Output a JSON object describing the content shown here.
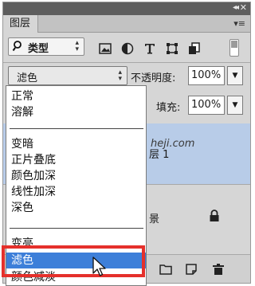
{
  "panel": {
    "tab_label": "图层",
    "collapse_glyph": "◂◂",
    "close_glyph": "✕",
    "menu_glyph": "▾≡"
  },
  "filter": {
    "kind_label": "类型",
    "kind_arrows": "▴▾",
    "icons": [
      "image-filter-icon",
      "adjustment-filter-icon",
      "type-filter-icon",
      "shape-filter-icon",
      "smart-object-filter-icon"
    ]
  },
  "blend": {
    "value": "滤色",
    "arrows": "▴▾",
    "opacity_label": "不透明度:",
    "opacity_value": "100%",
    "fill_label": "填充:",
    "fill_value": "100%",
    "dropdown_glyph": "▼"
  },
  "layers": {
    "selected_fragment": "层 1",
    "watermark": "heji.com",
    "background_fragment": "景"
  },
  "blend_menu": {
    "groups": [
      [
        "正常",
        "溶解"
      ],
      [
        "变暗",
        "正片叠底",
        "颜色加深",
        "线性加深",
        "深色"
      ],
      [
        "变亮",
        "滤色",
        "颜色减淡"
      ]
    ],
    "selected": "滤色"
  },
  "colors": {
    "selection_blue": "#3d7fd9",
    "layer_highlight": "#b8cce8",
    "annotation_red": "#e5302b",
    "panel_gray": "#d6d6d6",
    "titlebar": "#5e5e5e"
  }
}
